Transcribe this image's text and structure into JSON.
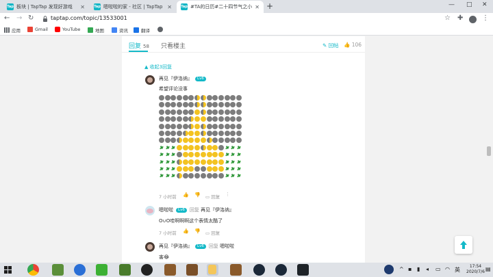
{
  "browser": {
    "tabs": [
      {
        "title": "板块 | TapTap 发现好游戏",
        "active": false
      },
      {
        "title": "嗯啦啦的家 - 社区 | TapTap 发现",
        "active": false
      },
      {
        "title": "#TA的日历#二十四节气之小暑 -",
        "active": true
      }
    ],
    "url": "taptap.com/topic/13533001",
    "bookmarks": [
      "应用",
      "Gmail",
      "YouTube",
      "地图",
      "资讯",
      "翻译"
    ]
  },
  "thread": {
    "tab_reply_label": "回复",
    "tab_reply_count": "58",
    "tab_author_only_label": "只看楼主",
    "reply_button_label": "回帖",
    "like_count": "106",
    "collapse_label": "收起3回复"
  },
  "comments": [
    {
      "user": "再见『伊洛纳』",
      "level": "Lv6",
      "text": "希望评论没事",
      "time": "7 小时前",
      "reply_label": "回复",
      "emoji_art": [
        "gggggghhgggggg",
        "gggggghhgggggg",
        "ggggggyhgggggg",
        "ggggghyygggggg",
        "ggggghyhgggggg",
        "gggghyyhgggggg",
        "ggghyyyyhggggg",
        "sssyyyyhyygsss",
        "sssgyyyyyyysss",
        "ssshyyyyyyysss",
        "sssyyyggyyysss",
        "ssshgggggggsss"
      ]
    },
    {
      "user": "嗯啦啦",
      "level": "Lv6",
      "reply_to_prefix": "回复",
      "reply_to": "再见『伊洛纳』",
      "text": "O∪O哇啊啊啊这个表情太酷了",
      "time": "7 小时前",
      "reply_label": "回复"
    },
    {
      "user": "再见『伊洛纳』",
      "level": "Lv6",
      "reply_to_prefix": "回复",
      "reply_to": "嗯啦啦",
      "text": "害😂"
    }
  ],
  "taskbar": {
    "time": "17:54",
    "date": "2020/7/6"
  },
  "colors": {
    "accent": "#14b9c8",
    "emoji_yellow": "#f3c321",
    "emoji_gray": "#7d7d7d"
  }
}
